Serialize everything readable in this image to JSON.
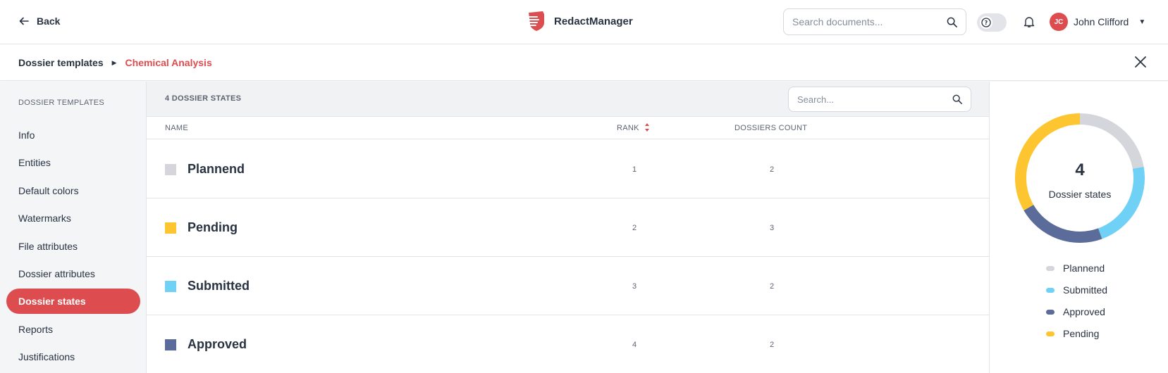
{
  "header": {
    "back_label": "Back",
    "brand": "RedactManager",
    "search_placeholder": "Search documents...",
    "user_initials": "JC",
    "user_name": "John Clifford"
  },
  "breadcrumb": {
    "parent": "Dossier templates",
    "current": "Chemical Analysis"
  },
  "sidebar": {
    "title": "DOSSIER TEMPLATES",
    "items": [
      {
        "label": "Info"
      },
      {
        "label": "Entities"
      },
      {
        "label": "Default colors"
      },
      {
        "label": "Watermarks"
      },
      {
        "label": "File attributes"
      },
      {
        "label": "Dossier attributes"
      },
      {
        "label": "Dossier states",
        "active": true
      },
      {
        "label": "Reports"
      },
      {
        "label": "Justifications"
      }
    ]
  },
  "main": {
    "count_label": "4 DOSSIER STATES",
    "search_placeholder": "Search...",
    "columns": {
      "name": "NAME",
      "rank": "RANK",
      "dossiers": "DOSSIERS COUNT"
    },
    "rows": [
      {
        "name": "Plannend",
        "rank": "1",
        "dossiers": "2",
        "color": "#d5d6db"
      },
      {
        "name": "Pending",
        "rank": "2",
        "dossiers": "3",
        "color": "#fdc530"
      },
      {
        "name": "Submitted",
        "rank": "3",
        "dossiers": "2",
        "color": "#6fd1f5"
      },
      {
        "name": "Approved",
        "rank": "4",
        "dossiers": "2",
        "color": "#5b6b9a"
      }
    ]
  },
  "summary": {
    "total": "4",
    "total_label": "Dossier states",
    "legend": [
      {
        "label": "Plannend",
        "color": "#d5d6db",
        "count": 2
      },
      {
        "label": "Submitted",
        "color": "#6fd1f5",
        "count": 2
      },
      {
        "label": "Approved",
        "color": "#5b6b9a",
        "count": 2
      },
      {
        "label": "Pending",
        "color": "#fdc530",
        "count": 3
      }
    ]
  },
  "colors": {
    "accent": "#dd4d50",
    "text": "#283241"
  }
}
